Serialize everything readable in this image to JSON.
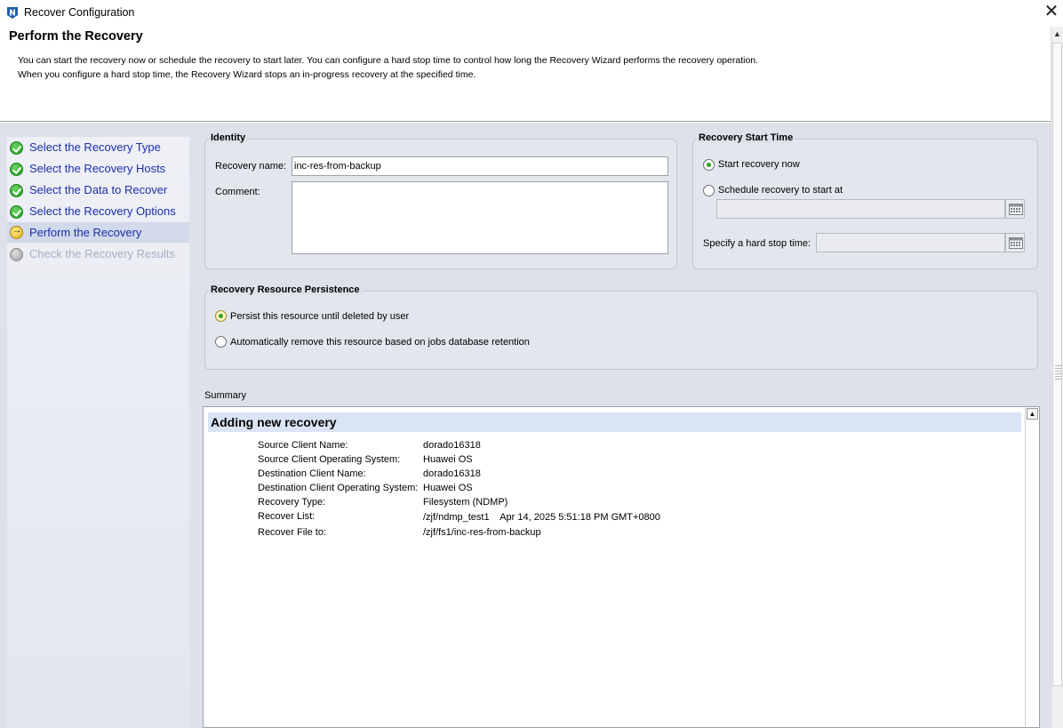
{
  "window": {
    "title": "Recover Configuration",
    "close_glyph": "✕"
  },
  "header": {
    "title": "Perform the Recovery",
    "description_line1": "You can start the recovery now or schedule the recovery to start later.  You can configure a hard stop time to control how long the Recovery Wizard performs the recovery operation.",
    "description_line2": "When you configure a hard stop time, the Recovery Wizard stops an in-progress recovery at the specified time."
  },
  "steps": [
    {
      "label": "Select the Recovery Type",
      "state": "done"
    },
    {
      "label": "Select the Recovery Hosts",
      "state": "done"
    },
    {
      "label": "Select the Data to Recover",
      "state": "done"
    },
    {
      "label": "Select the Recovery Options",
      "state": "done"
    },
    {
      "label": "Perform the Recovery",
      "state": "current"
    },
    {
      "label": "Check the Recovery Results",
      "state": "pending"
    }
  ],
  "identity": {
    "title": "Identity",
    "name_label": "Recovery name:",
    "name_value": "inc-res-from-backup",
    "comment_label": "Comment:",
    "comment_value": ""
  },
  "start_time": {
    "title": "Recovery Start Time",
    "now_label": "Start recovery now",
    "schedule_label": "Schedule recovery to start at",
    "schedule_value": "",
    "hard_stop_label": "Specify a hard stop time:",
    "hard_stop_value": "",
    "selected": "now"
  },
  "persistence": {
    "title": "Recovery Resource Persistence",
    "persist_label": "Persist this resource until deleted by user",
    "auto_remove_label": "Automatically remove this resource based on jobs database retention",
    "selected": "persist"
  },
  "summary": {
    "label": "Summary",
    "heading": "Adding new recovery",
    "rows": [
      {
        "key": "Source Client Name:",
        "value": "dorado16318"
      },
      {
        "key": "Source Client Operating System:",
        "value": "Huawei OS"
      },
      {
        "key": "Destination Client Name:",
        "value": "dorado16318"
      },
      {
        "key": "Destination Client Operating System:",
        "value": "Huawei OS"
      },
      {
        "key": "Recovery Type:",
        "value": "Filesystem (NDMP)"
      },
      {
        "key": "Recover List:",
        "value": "/zjf/ndmp_test1    Apr 14, 2025 5:51:18 PM GMT+0800"
      },
      {
        "key": "Recover File to:",
        "value": "/zjf/fs1/inc-res-from-backup"
      }
    ]
  },
  "icons": {
    "logo": "networker-logo-icon",
    "done": "green-check-icon",
    "current": "arrow-current-icon",
    "pending": "gray-circle-icon",
    "calendar": "calendar-icon"
  },
  "colors": {
    "step_link": "#1a2ea8",
    "step_pending": "#a6aec4",
    "panel_bg": "#dee1e9",
    "summary_head": "#d9e5f6"
  }
}
